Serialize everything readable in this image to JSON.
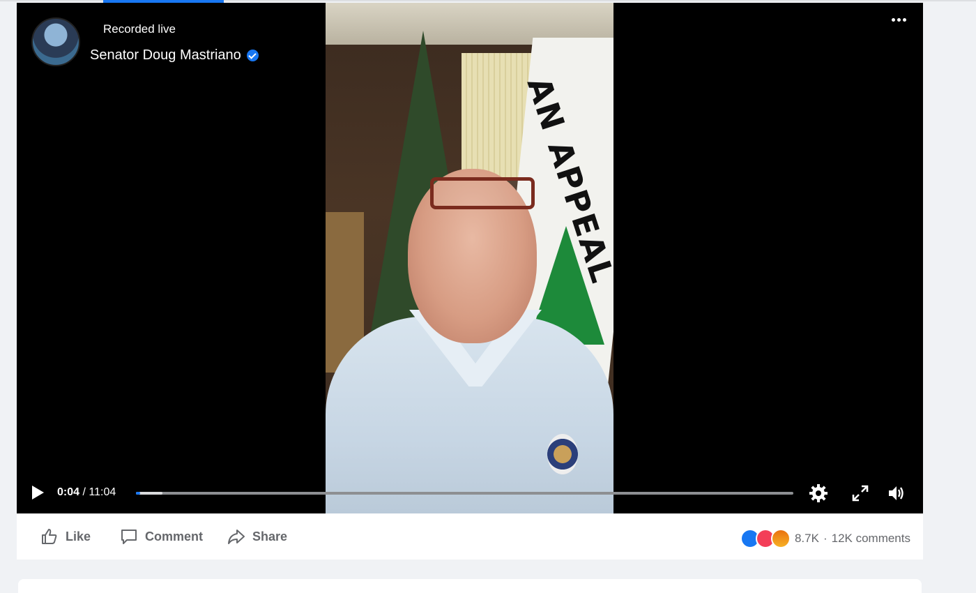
{
  "header": {
    "status": "Recorded live",
    "author": "Senator Doug Mastriano"
  },
  "video": {
    "flag_text": "AN APPEAL",
    "current_time": "0:04",
    "separator": "/",
    "duration": "11:04",
    "progress_fraction": 0.006,
    "buffered_fraction": 0.04
  },
  "actions": {
    "like_label": "Like",
    "comment_label": "Comment",
    "share_label": "Share"
  },
  "engagement": {
    "reactions": [
      "like",
      "love",
      "angry"
    ],
    "reaction_count": "8.7K",
    "dot": "·",
    "comments": "12K comments"
  },
  "colors": {
    "accent": "#1877f2",
    "love": "#f33e58",
    "angry": "#e9710f"
  },
  "icons": [
    "play-icon",
    "settings-icon",
    "fullscreen-icon",
    "volume-icon",
    "like-icon",
    "comment-icon",
    "share-icon",
    "more-icon",
    "verified-icon"
  ]
}
